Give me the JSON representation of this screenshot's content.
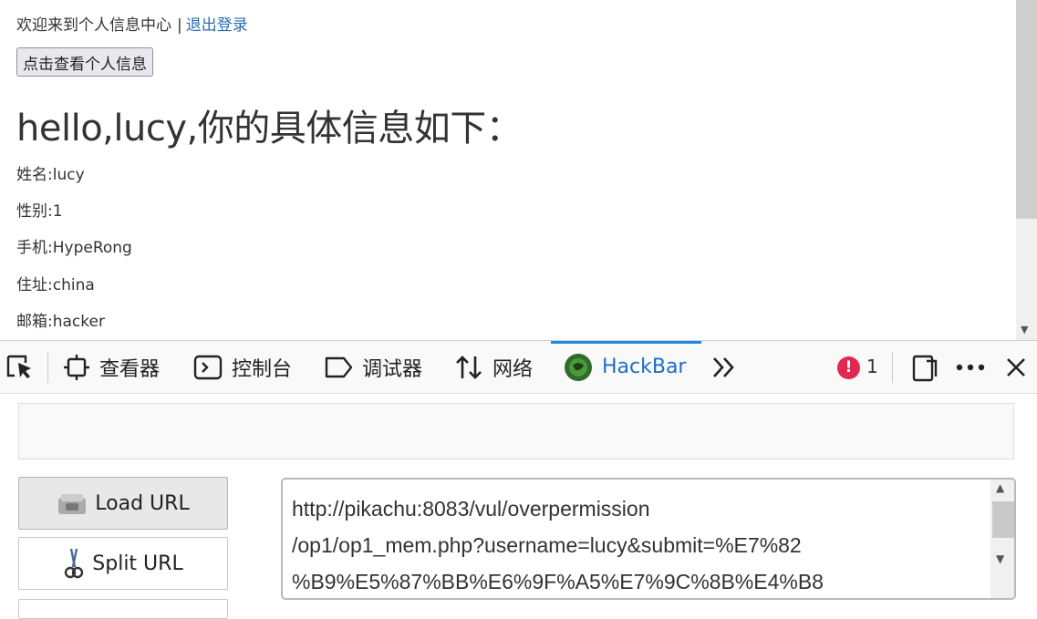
{
  "page": {
    "welcome_text": "欢迎来到个人信息中心",
    "separator": "|",
    "logout_link": "退出登录",
    "view_button": "点击查看个人信息",
    "heading": "hello,lucy,你的具体信息如下：",
    "fields": [
      "姓名:lucy",
      "性别:1",
      "手机:HypeRong",
      "住址:china",
      "邮箱:hacker"
    ]
  },
  "devtools": {
    "tabs": {
      "inspector": "查看器",
      "console": "控制台",
      "debugger": "调试器",
      "network": "网络",
      "hackbar": "HackBar"
    },
    "error_count": "1",
    "active_color": "#1e6fc4",
    "error_color": "#e22850"
  },
  "hackbar": {
    "load_url": "Load URL",
    "split_url": "Split URL",
    "url_value": "http://pikachu:8083/vul/overpermission\n/op1/op1_mem.php?username=lucy&submit=%E7%82\n%B9%E5%87%BB%E6%9F%A5%E7%9C%8B%E4%B8"
  }
}
